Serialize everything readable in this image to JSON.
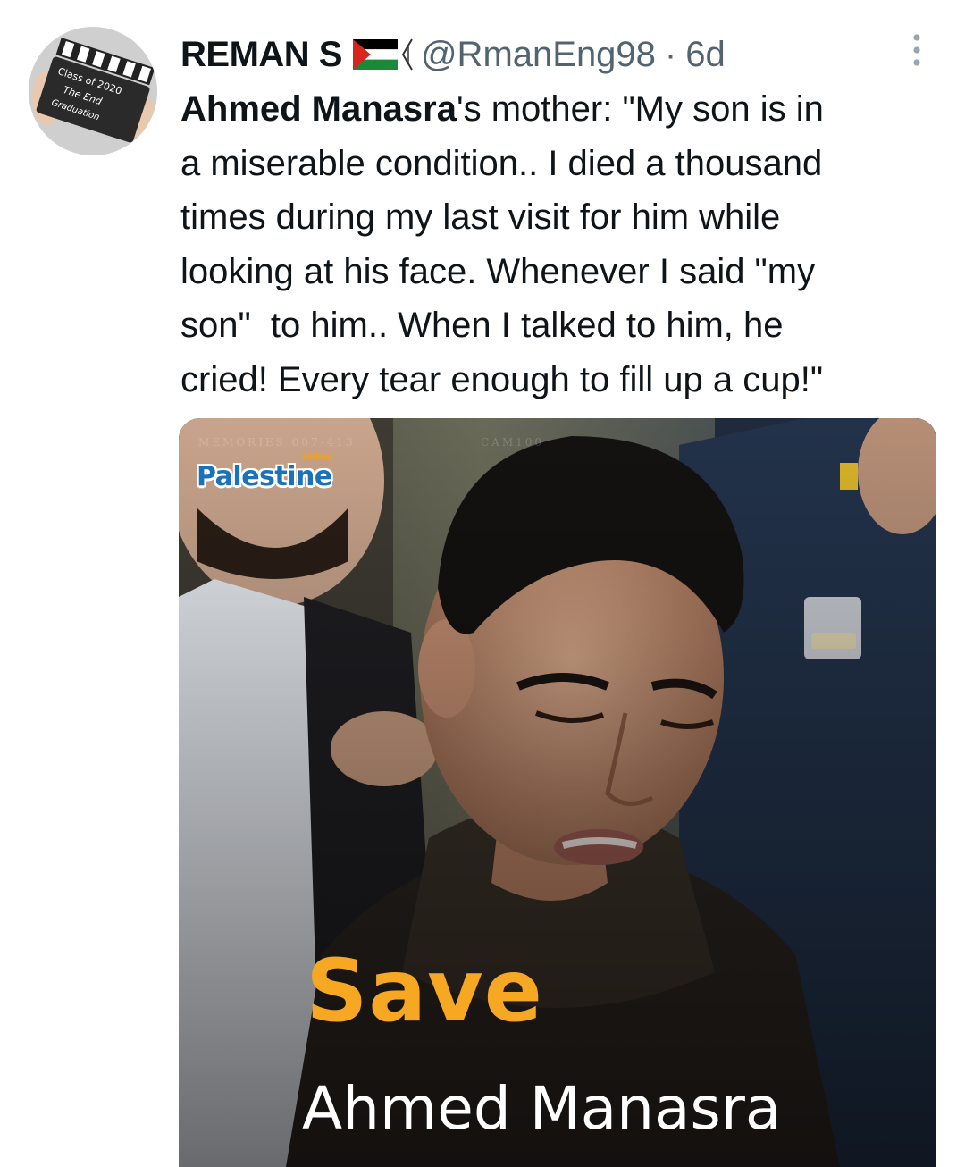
{
  "tweet": {
    "display_name": "REMAN S",
    "handle": "@RmanEng98",
    "separator": "·",
    "time": "6d",
    "text_mention": "Ahmed Manasra",
    "text_body": "'s mother: \"My son is in\na miserable condition.. I died a thousand\ntimes during my last visit for him while\nlooking at his face. Whenever I said \"my\nson\"  to him.. When I talked to him, he\ncried! Every tear enough to fill up a cup!\"",
    "more_icon": "more-vertical-icon"
  },
  "avatar": {
    "clapper_lines": [
      "Class of 2020",
      "The End",
      "Graduation"
    ]
  },
  "media": {
    "logo_text": "Palestine",
    "logo_sub": "Online",
    "watermark_left": "MEMORIES 007-413",
    "watermark_right": "CAM100",
    "headline": "Save",
    "subheadline": "Ahmed Manasra"
  },
  "colors": {
    "name": "#0f1419",
    "secondary": "#536471",
    "save": "#f7a823",
    "logo_blue": "#1a73b8",
    "logo_orange": "#f2a21b"
  }
}
